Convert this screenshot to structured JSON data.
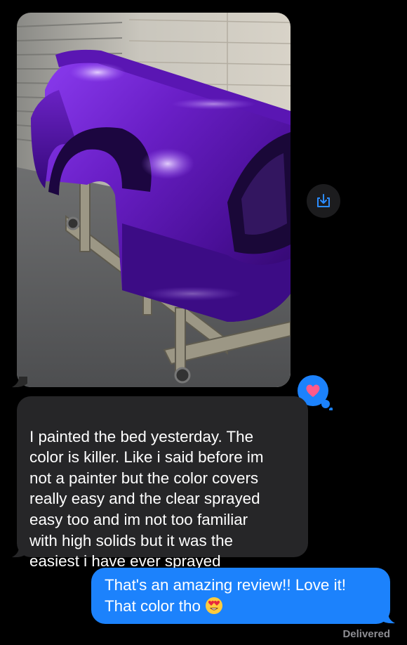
{
  "conversation": {
    "top_partial_text": "…",
    "photo": {
      "alt": "Purple painted truck bed on stand in spray booth"
    },
    "save_icon": "download-to-tray-icon",
    "reaction_icon": "heart-icon",
    "incoming_message": "I painted the bed yesterday. The\ncolor is killer. Like i said before im\nnot a painter but the color covers\nreally easy and the clear sprayed\neasy too and im not too familiar\nwith high solids but it was the\neasiest i have ever sprayed",
    "outgoing_message_line1": "That's an amazing review!! Love it!",
    "outgoing_message_line2": "That color tho",
    "outgoing_emoji": "heart-eyes-emoji",
    "status": "Delivered"
  },
  "colors": {
    "background": "#000000",
    "incoming_bubble": "#262628",
    "outgoing_bubble": "#1c82fc",
    "reaction_bubble": "#1c82fc",
    "heart": "#ff5a8a",
    "paint_purple": "#6a1fc7"
  }
}
